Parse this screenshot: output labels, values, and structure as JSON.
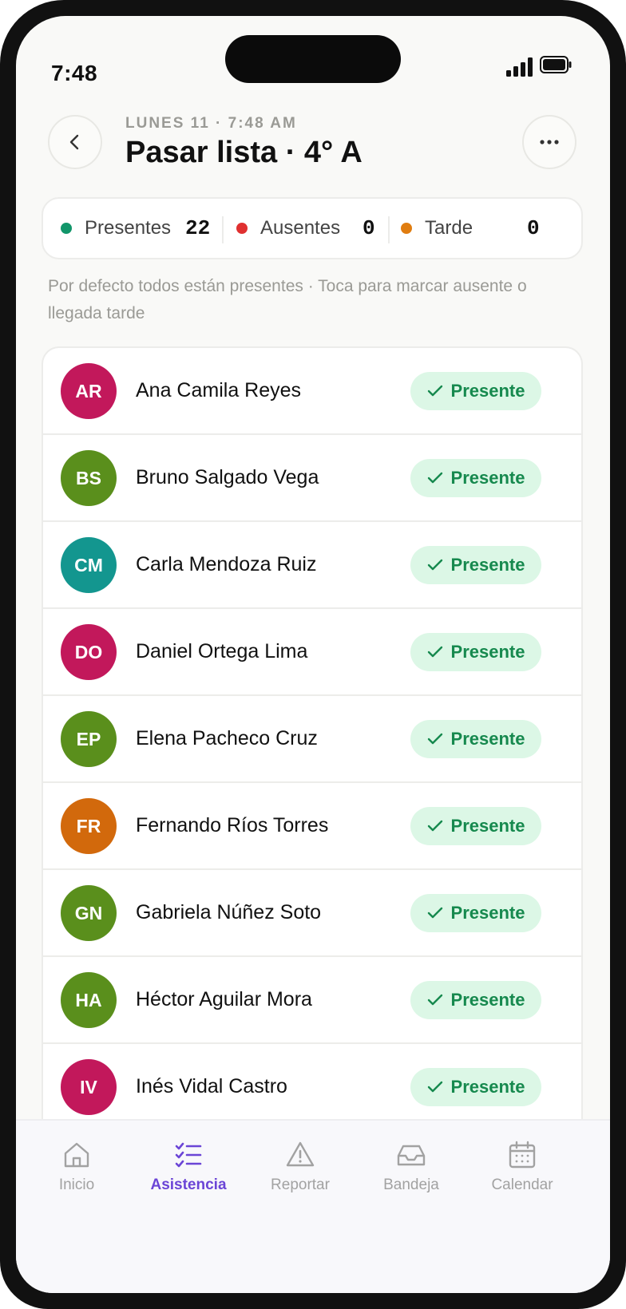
{
  "status": {
    "time": "7:48"
  },
  "header": {
    "date": "LUNES 11 · 7:48 AM",
    "title": "Pasar lista · 4° A"
  },
  "summary": [
    {
      "label": "Presentes",
      "count": "22",
      "color": "#12966a"
    },
    {
      "label": "Ausentes",
      "count": "0",
      "color": "#e03030"
    },
    {
      "label": "Tarde",
      "count": "0",
      "color": "#e07d10"
    }
  ],
  "hint": "Por defecto todos están presentes · Toca para marcar ausente o llegada tarde",
  "students": [
    {
      "initials": "AR",
      "name": "Ana Camila Reyes",
      "status": "Presente",
      "color": "#c2185b"
    },
    {
      "initials": "BS",
      "name": "Bruno Salgado Vega",
      "status": "Presente",
      "color": "#5a8f1c"
    },
    {
      "initials": "CM",
      "name": "Carla Mendoza Ruiz",
      "status": "Presente",
      "color": "#13968f"
    },
    {
      "initials": "DO",
      "name": "Daniel Ortega Lima",
      "status": "Presente",
      "color": "#c2185b"
    },
    {
      "initials": "EP",
      "name": "Elena Pacheco Cruz",
      "status": "Presente",
      "color": "#5a8f1c"
    },
    {
      "initials": "FR",
      "name": "Fernando Ríos Torres",
      "status": "Presente",
      "color": "#d2690c"
    },
    {
      "initials": "GN",
      "name": "Gabriela Núñez Soto",
      "status": "Presente",
      "color": "#5a8f1c"
    },
    {
      "initials": "HA",
      "name": "Héctor Aguilar Mora",
      "status": "Presente",
      "color": "#5a8f1c"
    },
    {
      "initials": "IV",
      "name": "Inés Vidal Castro",
      "status": "Presente",
      "color": "#c2185b"
    }
  ],
  "tabs": [
    {
      "label": "Inicio",
      "icon": "home-icon",
      "active": false
    },
    {
      "label": "Asistencia",
      "icon": "checklist-icon",
      "active": true
    },
    {
      "label": "Reportar",
      "icon": "warning-icon",
      "active": false
    },
    {
      "label": "Bandeja",
      "icon": "inbox-icon",
      "active": false
    },
    {
      "label": "Calendar",
      "icon": "calendar-icon",
      "active": false
    }
  ],
  "colors": {
    "accent": "#6b45d6",
    "present_bg": "#dcf7e6",
    "present_text": "#16894e"
  }
}
